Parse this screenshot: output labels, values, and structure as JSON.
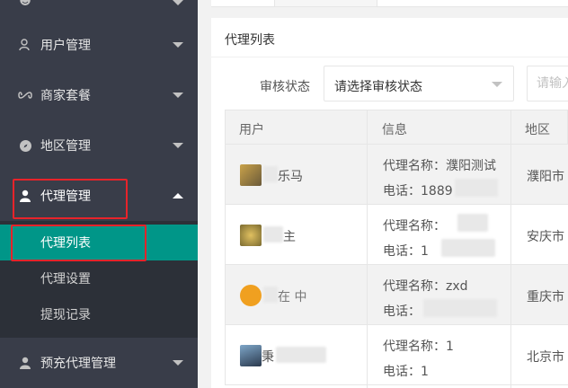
{
  "sidebar": {
    "items": [
      {
        "label": "用户管理",
        "icon": "user-group-icon"
      },
      {
        "label": "商家套餐",
        "icon": "infinity-icon"
      },
      {
        "label": "地区管理",
        "icon": "compass-icon"
      },
      {
        "label": "代理管理",
        "icon": "person-icon"
      },
      {
        "label": "预充代理管理",
        "icon": "person-icon"
      }
    ],
    "submenu": [
      {
        "label": "代理列表"
      },
      {
        "label": "代理设置"
      },
      {
        "label": "提现记录"
      }
    ]
  },
  "card": {
    "title": "代理列表"
  },
  "filter": {
    "status_label": "审核状态",
    "status_value": "请选择审核状态",
    "search_placeholder": "请输入"
  },
  "table": {
    "headers": [
      "用户",
      "信息",
      "地区"
    ],
    "rows": [
      {
        "user": "乐马",
        "info_name": "代理名称：濮阳测试",
        "info_phone": "电话：1889",
        "region": "濮阳市"
      },
      {
        "user": "主",
        "info_name": "代理名称：",
        "info_phone": "电话：1",
        "region": "安庆市"
      },
      {
        "user": "在  中",
        "info_name": "代理名称：zxd",
        "info_phone": "电话：",
        "region": "重庆市"
      },
      {
        "user": "秉",
        "info_name": "代理名称：1",
        "info_phone": "电话：1",
        "region": "北京市"
      }
    ]
  },
  "colors": {
    "sidebar_bg": "#393d49",
    "submenu_bg": "#2c3038",
    "active_bg": "#009688",
    "highlight": "#e8232a"
  }
}
